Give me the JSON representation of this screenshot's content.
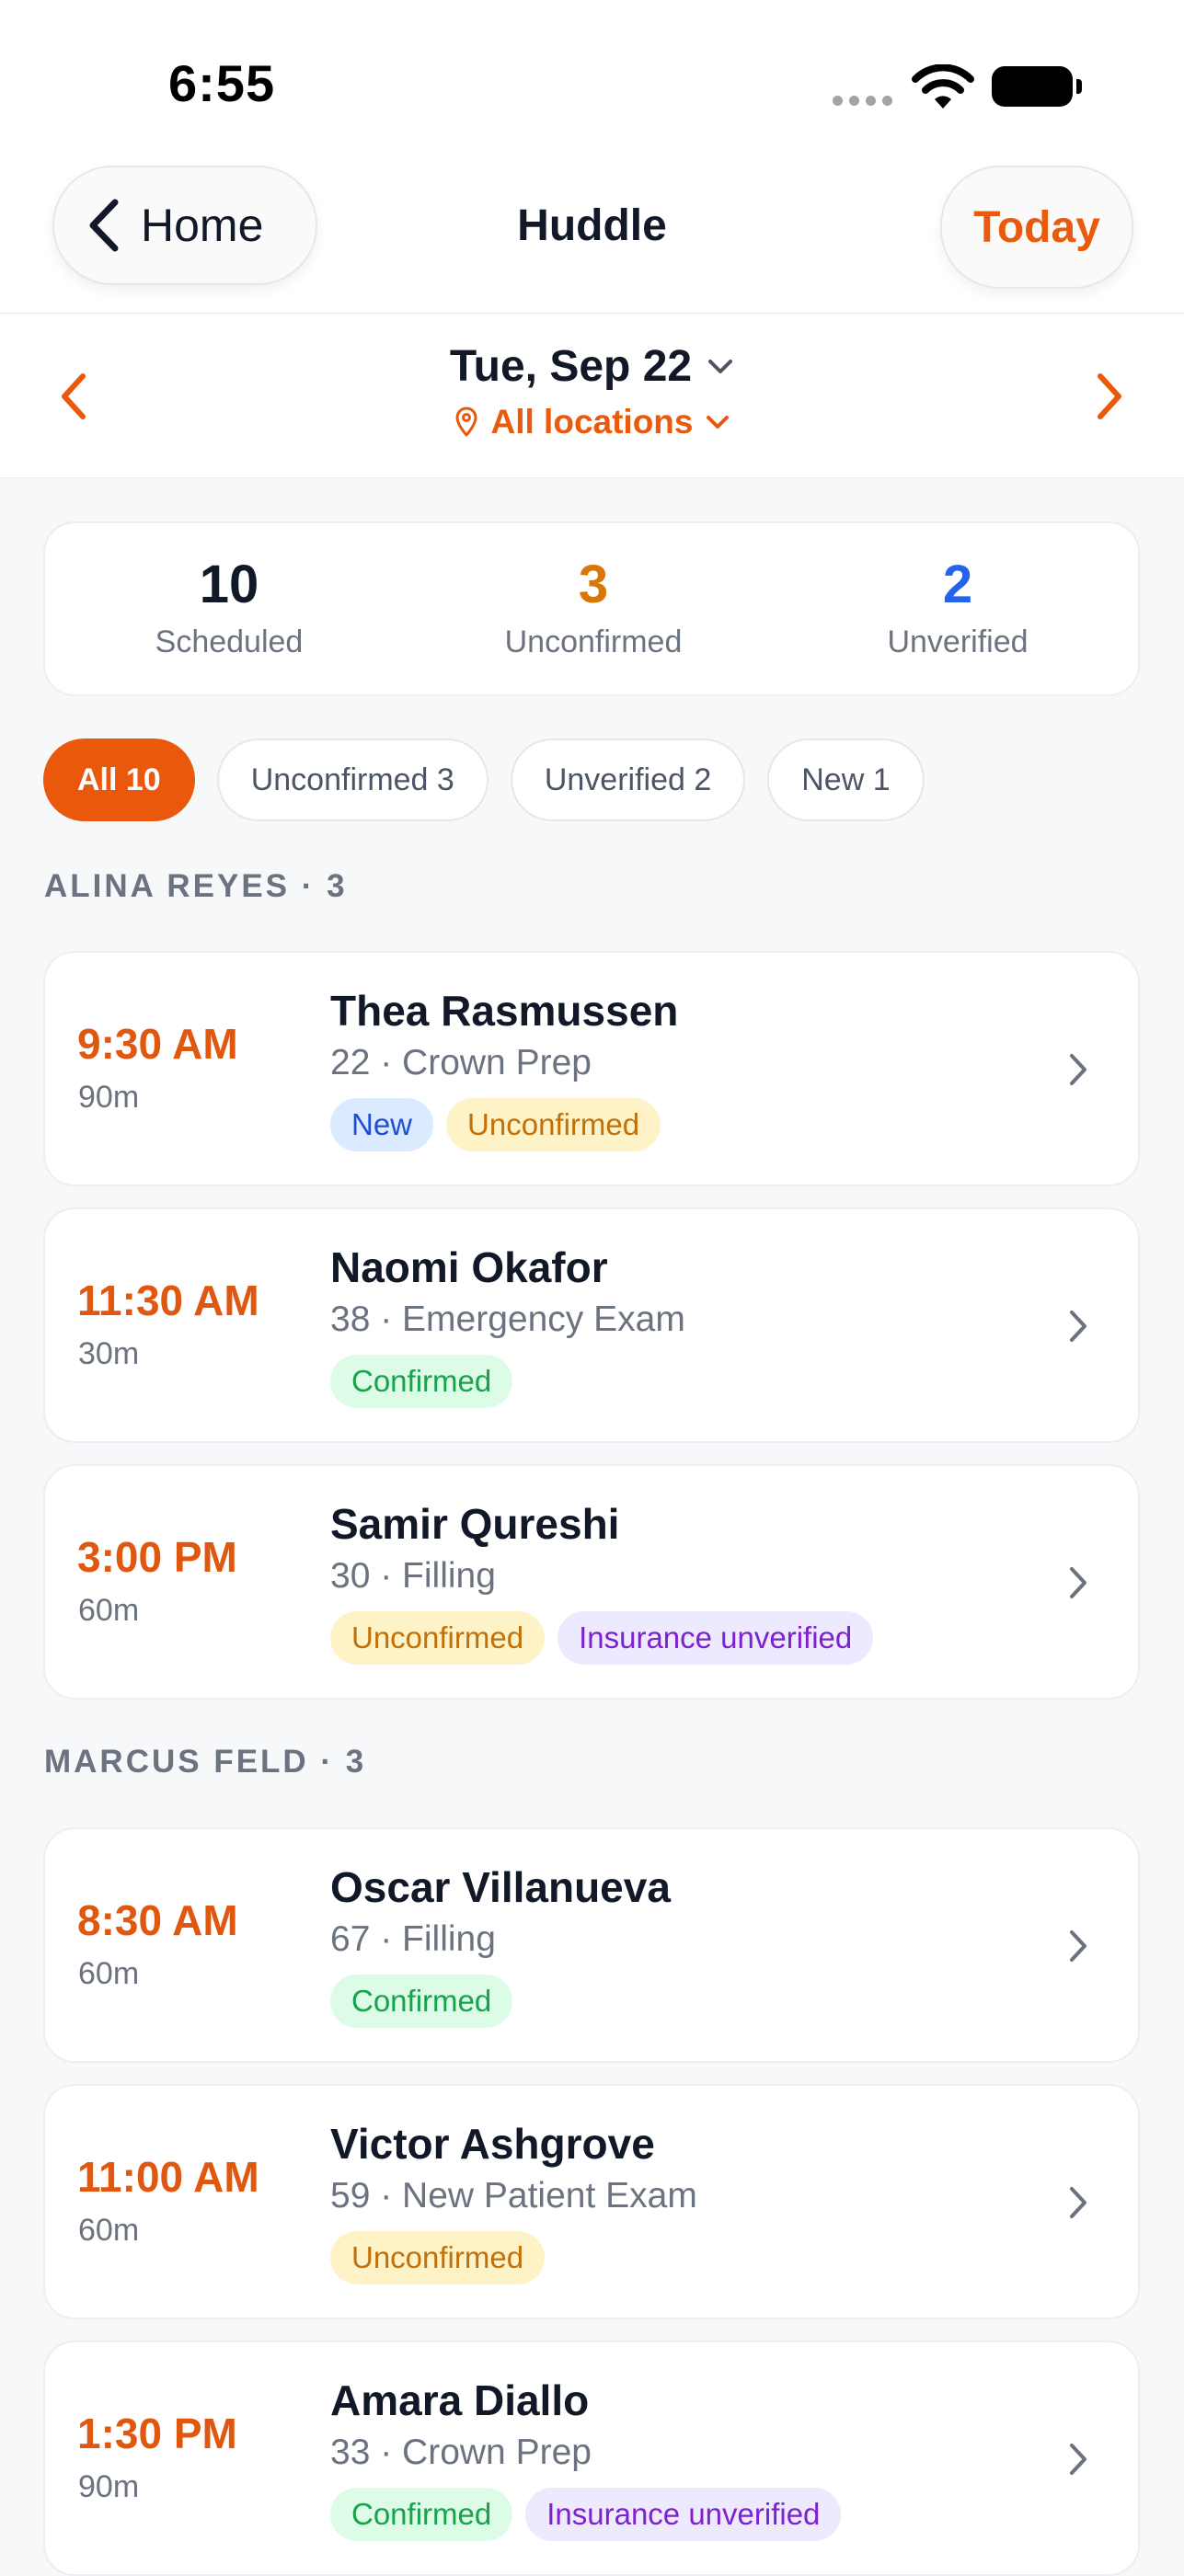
{
  "status_bar": {
    "time": "6:55"
  },
  "nav": {
    "back_label": "Home",
    "title": "Huddle",
    "today_label": "Today"
  },
  "date_bar": {
    "date": "Tue, Sep 22",
    "location": "All locations"
  },
  "summary": [
    {
      "value": "10",
      "label": "Scheduled",
      "color": "#111827"
    },
    {
      "value": "3",
      "label": "Unconfirmed",
      "color": "#d97706"
    },
    {
      "value": "2",
      "label": "Unverified",
      "color": "#2563eb"
    }
  ],
  "filters": [
    {
      "label": "All 10",
      "active": true
    },
    {
      "label": "Unconfirmed 3",
      "active": false
    },
    {
      "label": "Unverified 2",
      "active": false
    },
    {
      "label": "New 1",
      "active": false
    }
  ],
  "groups": [
    {
      "header": "ALINA REYES · 3",
      "appointments": [
        {
          "time": "9:30 AM",
          "duration": "90m",
          "name": "Thea Rasmussen",
          "detail": "22 · Crown Prep",
          "tags": [
            {
              "label": "New",
              "kind": "new"
            },
            {
              "label": "Unconfirmed",
              "kind": "unconfirmed"
            }
          ]
        },
        {
          "time": "11:30 AM",
          "duration": "30m",
          "name": "Naomi Okafor",
          "detail": "38 · Emergency Exam",
          "tags": [
            {
              "label": "Confirmed",
              "kind": "confirmed"
            }
          ]
        },
        {
          "time": "3:00 PM",
          "duration": "60m",
          "name": "Samir Qureshi",
          "detail": "30 · Filling",
          "tags": [
            {
              "label": "Unconfirmed",
              "kind": "unconfirmed"
            },
            {
              "label": "Insurance unverified",
              "kind": "insurance"
            }
          ]
        }
      ]
    },
    {
      "header": "MARCUS FELD · 3",
      "appointments": [
        {
          "time": "8:30 AM",
          "duration": "60m",
          "name": "Oscar Villanueva",
          "detail": "67 · Filling",
          "tags": [
            {
              "label": "Confirmed",
              "kind": "confirmed"
            }
          ]
        },
        {
          "time": "11:00 AM",
          "duration": "60m",
          "name": "Victor Ashgrove",
          "detail": "59 · New Patient Exam",
          "tags": [
            {
              "label": "Unconfirmed",
              "kind": "unconfirmed"
            }
          ]
        },
        {
          "time": "1:30 PM",
          "duration": "90m",
          "name": "Amara Diallo",
          "detail": "33 · Crown Prep",
          "tags": [
            {
              "label": "Confirmed",
              "kind": "confirmed"
            },
            {
              "label": "Insurance unverified",
              "kind": "insurance"
            }
          ]
        }
      ]
    }
  ],
  "colors": {
    "accent": "#ea580c",
    "background": "#f7f8fa"
  }
}
